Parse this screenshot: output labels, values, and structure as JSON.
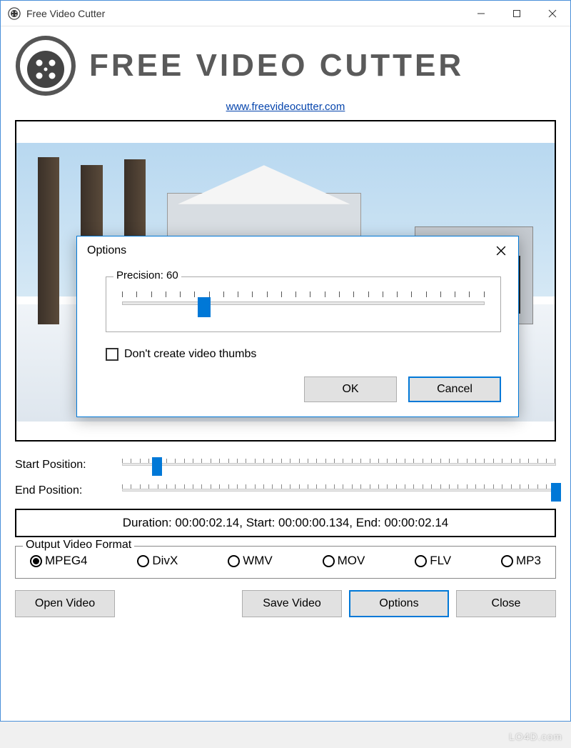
{
  "window": {
    "title": "Free Video Cutter"
  },
  "header": {
    "app_name": "FREE VIDEO CUTTER",
    "url": "www.freevideocutter.com"
  },
  "sliders": {
    "start_label": "Start Position:",
    "start_percent": 8,
    "end_label": "End Position:",
    "end_percent": 100
  },
  "info": {
    "text": "Duration: 00:00:02.14, Start: 00:00:00.134, End: 00:00:02.14"
  },
  "format": {
    "legend": "Output Video Format",
    "options": [
      "MPEG4",
      "DivX",
      "WMV",
      "MOV",
      "FLV",
      "MP3"
    ],
    "selected": "MPEG4"
  },
  "buttons": {
    "open": "Open Video",
    "save": "Save Video",
    "options": "Options",
    "close": "Close"
  },
  "modal": {
    "title": "Options",
    "precision_label": "Precision: 60",
    "precision_percent": 22,
    "checkbox_label": "Don't create video thumbs",
    "checkbox_checked": false,
    "ok": "OK",
    "cancel": "Cancel"
  },
  "watermark": "LO4D.com"
}
